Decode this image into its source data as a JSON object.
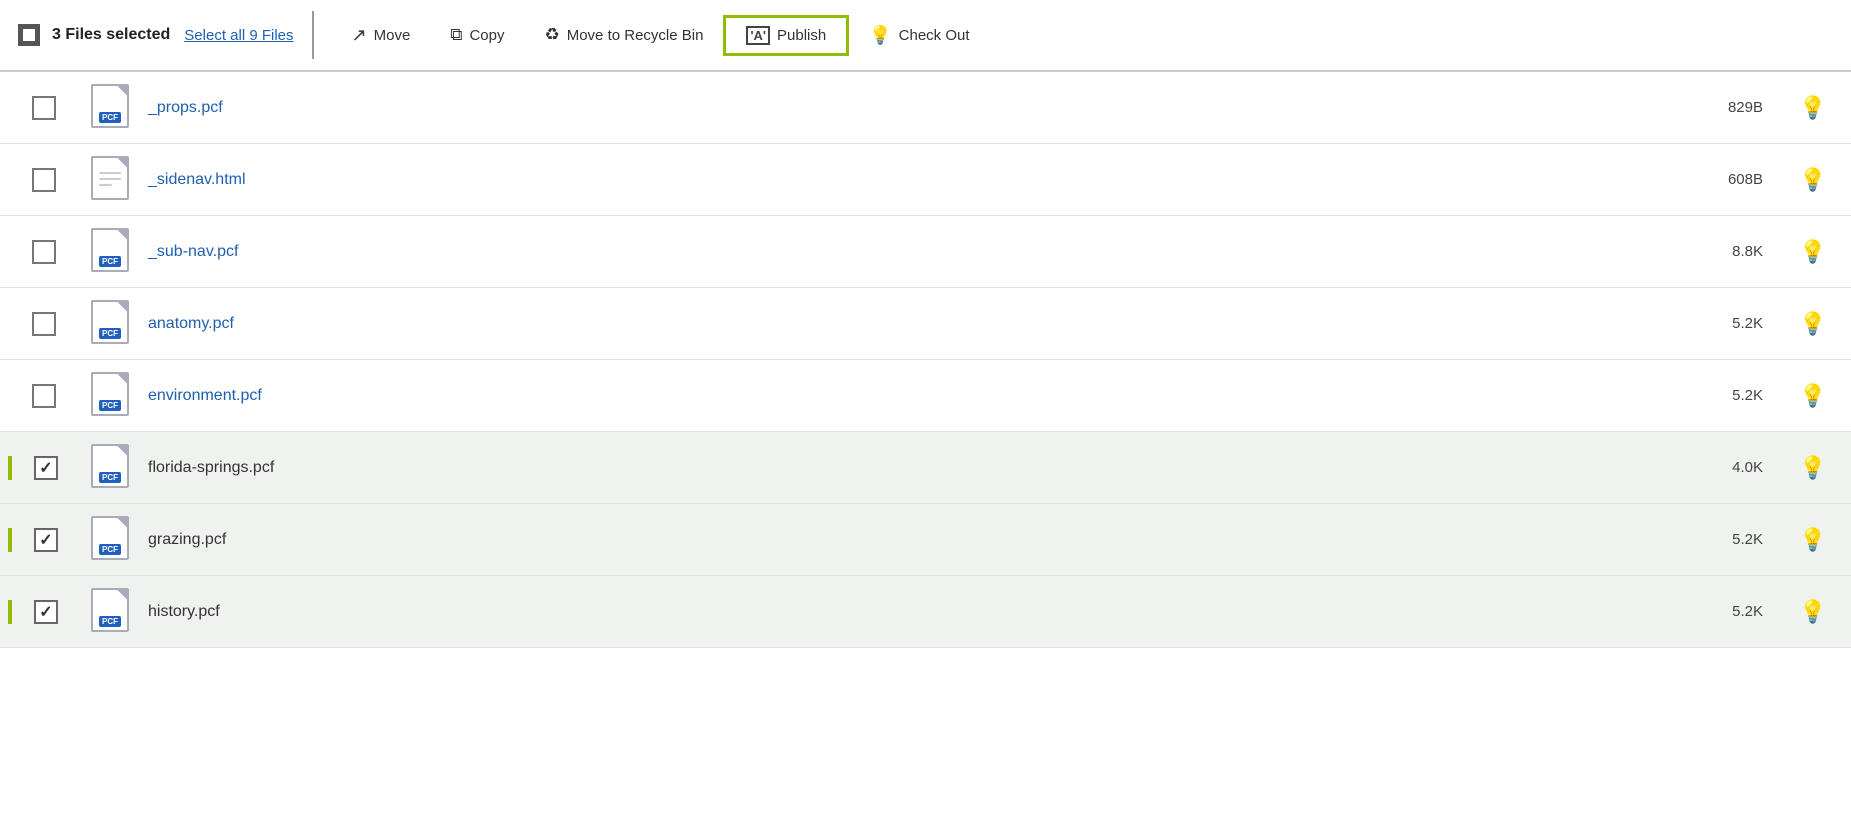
{
  "toolbar": {
    "checkbox_state": "indeterminate",
    "selected_label": "3 Files selected",
    "select_all_label": "Select all 9 Files",
    "move_label": "Move",
    "copy_label": "Copy",
    "recycle_label": "Move to Recycle Bin",
    "publish_label": "Publish",
    "checkout_label": "Check Out"
  },
  "files": [
    {
      "name": "_props.pcf",
      "type": "pcf",
      "size": "829B",
      "checked": false,
      "link": true
    },
    {
      "name": "_sidenav.html",
      "type": "html",
      "size": "608B",
      "checked": false,
      "link": true
    },
    {
      "name": "_sub-nav.pcf",
      "type": "pcf",
      "size": "8.8K",
      "checked": false,
      "link": true
    },
    {
      "name": "anatomy.pcf",
      "type": "pcf",
      "size": "5.2K",
      "checked": false,
      "link": true
    },
    {
      "name": "environment.pcf",
      "type": "pcf",
      "size": "5.2K",
      "checked": false,
      "link": true
    },
    {
      "name": "florida-springs.pcf",
      "type": "pcf",
      "size": "4.0K",
      "checked": true,
      "link": false
    },
    {
      "name": "grazing.pcf",
      "type": "pcf",
      "size": "5.2K",
      "checked": true,
      "link": false
    },
    {
      "name": "history.pcf",
      "type": "pcf",
      "size": "5.2K",
      "checked": true,
      "link": false
    }
  ]
}
